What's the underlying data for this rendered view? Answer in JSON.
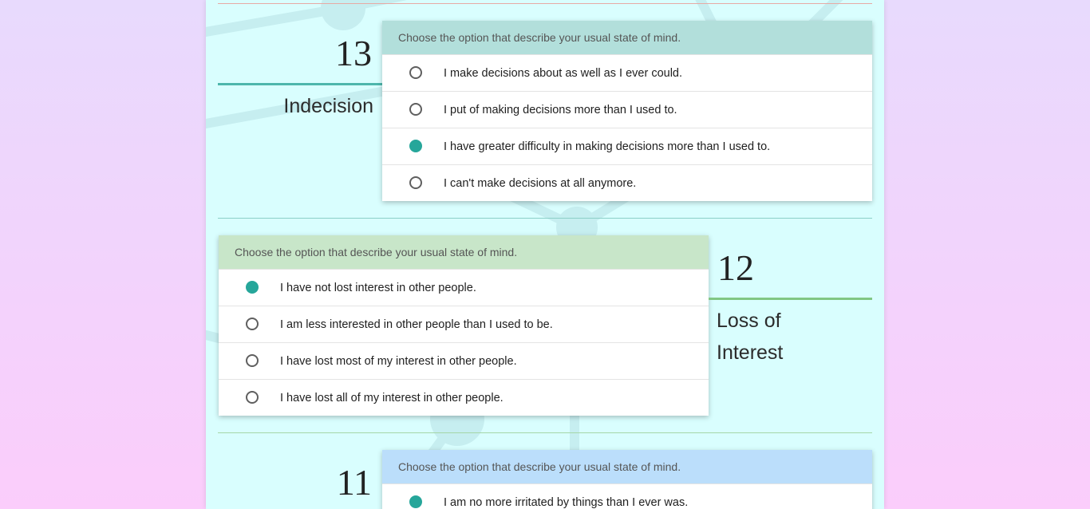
{
  "colors": {
    "page_bg": "#d9fefe",
    "accent_teal": "#26a69a",
    "header_q13": "#b2dfdb",
    "header_q12": "#c8e6c9",
    "header_q11": "#bbdefb",
    "rule_q13": "#4db6ac",
    "rule_q12": "#81c784"
  },
  "questions": [
    {
      "number": "13",
      "title": "Indecision",
      "prompt": "Choose the option that describe your usual state of mind.",
      "options": [
        {
          "label": "I make decisions about as well as I ever could.",
          "selected": false
        },
        {
          "label": "I put of making decisions more than I used to.",
          "selected": false
        },
        {
          "label": "I have greater difficulty in making decisions more than I used to.",
          "selected": true
        },
        {
          "label": "I can't make decisions at all anymore.",
          "selected": false
        }
      ]
    },
    {
      "number": "12",
      "title": "Loss of Interest",
      "prompt": "Choose the option that describe your usual state of mind.",
      "options": [
        {
          "label": "I have not lost interest in other people.",
          "selected": true
        },
        {
          "label": "I am less interested in other people than I used to be.",
          "selected": false
        },
        {
          "label": "I have lost most of my interest in other people.",
          "selected": false
        },
        {
          "label": "I have lost all of my interest in other people.",
          "selected": false
        }
      ]
    },
    {
      "number": "11",
      "title": "",
      "prompt": "Choose the option that describe your usual state of mind.",
      "options": [
        {
          "label": "I am no more irritated by things than I ever was.",
          "selected": true
        }
      ]
    }
  ]
}
